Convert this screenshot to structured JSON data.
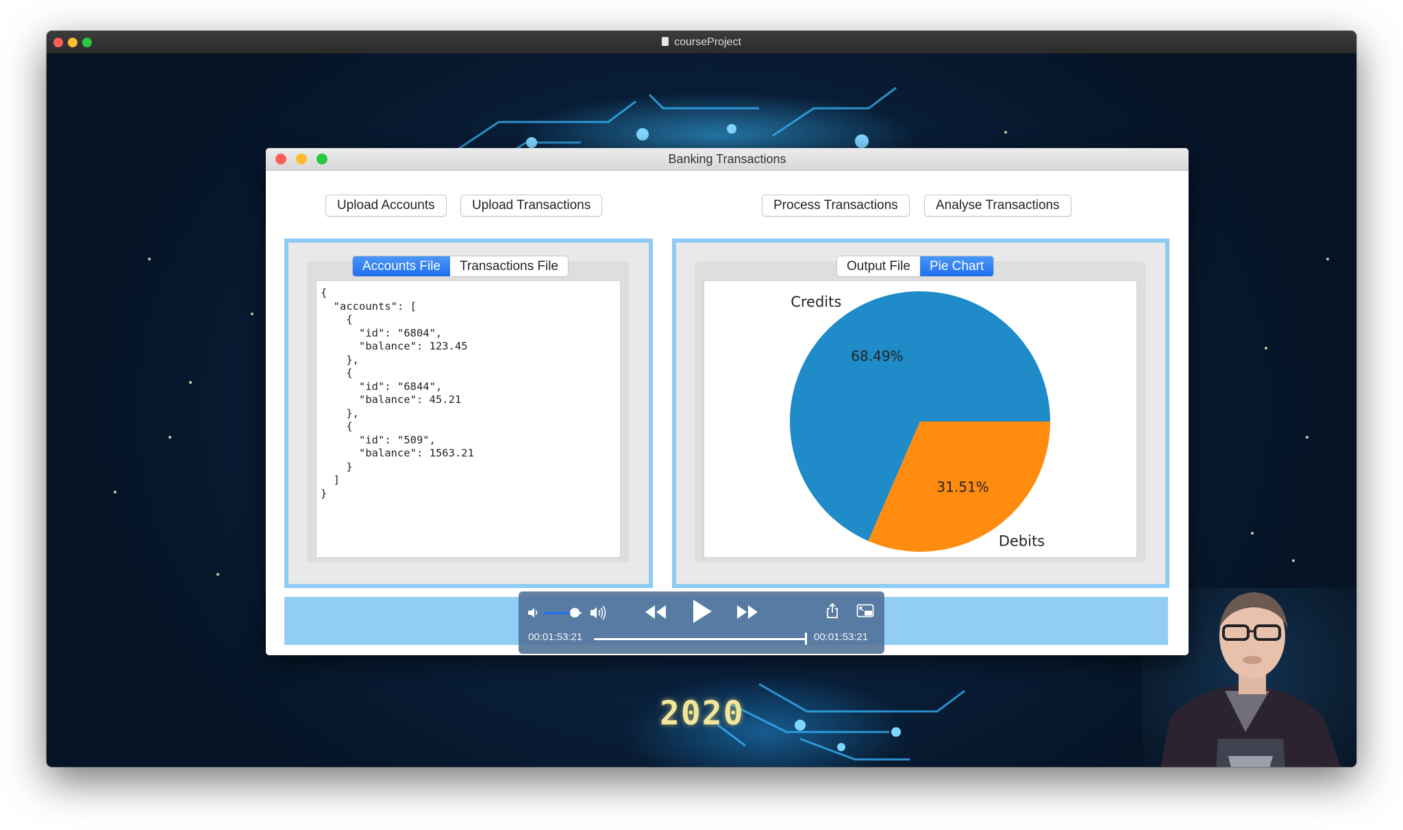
{
  "outer_window": {
    "title": "courseProject",
    "traffic_colors": [
      "#ff5f57",
      "#febc2e",
      "#28c840"
    ]
  },
  "background": {
    "year": "2020"
  },
  "app": {
    "title": "Banking Transactions",
    "buttons": {
      "upload_accounts": "Upload Accounts",
      "upload_transactions": "Upload Transactions",
      "process_transactions": "Process Transactions",
      "analyse_transactions": "Analyse Transactions"
    },
    "left_panel": {
      "tabs": [
        "Accounts File",
        "Transactions File"
      ],
      "active_tab": "Accounts File",
      "file_content": "{\n  \"accounts\": [\n    {\n      \"id\": \"6804\",\n      \"balance\": 123.45\n    },\n    {\n      \"id\": \"6844\",\n      \"balance\": 45.21\n    },\n    {\n      \"id\": \"509\",\n      \"balance\": 1563.21\n    }\n  ]\n}"
    },
    "right_panel": {
      "tabs": [
        "Output File",
        "Pie Chart"
      ],
      "active_tab": "Pie Chart"
    },
    "accent_color": "#8ecbf3",
    "tab_active_color": "#2a7ef2"
  },
  "chart_data": {
    "type": "pie",
    "labels": [
      "Credits",
      "Debits"
    ],
    "values": [
      68.49,
      31.51
    ],
    "value_labels": [
      "68.49%",
      "31.51%"
    ],
    "colors": [
      "#1f8bc8",
      "#ff8c0f"
    ]
  },
  "media_controls": {
    "elapsed": "00:01:53:21",
    "remaining": "00:01:53:21",
    "volume_fraction": 0.82,
    "progress_fraction": 1.0,
    "icons": [
      "volume-low-icon",
      "volume-high-icon",
      "rewind-icon",
      "play-icon",
      "fast-forward-icon",
      "share-icon",
      "picture-in-picture-icon"
    ]
  }
}
